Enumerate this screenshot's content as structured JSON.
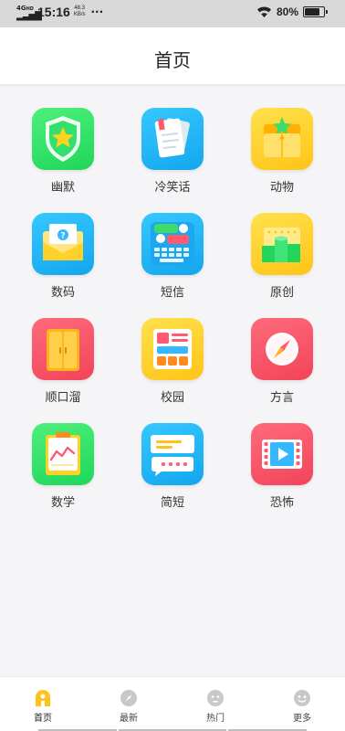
{
  "status_bar": {
    "network": "4G",
    "network_hd": "HD",
    "time": "15:16",
    "speed_value": "48.3",
    "speed_unit": "KB/s",
    "more": "···",
    "battery": "80%",
    "battery_level": 0.8
  },
  "header": {
    "title": "首页"
  },
  "categories": [
    {
      "label": "幽默",
      "icon": "shield-star-icon",
      "color": "green"
    },
    {
      "label": "冷笑话",
      "icon": "notebook-icon",
      "color": "blue"
    },
    {
      "label": "动物",
      "icon": "folder-star-icon",
      "color": "yellow"
    },
    {
      "label": "数码",
      "icon": "envelope-question-icon",
      "color": "blue"
    },
    {
      "label": "短信",
      "icon": "chat-keyboard-icon",
      "color": "blue"
    },
    {
      "label": "原创",
      "icon": "bar-chart-icon",
      "color": "yellow"
    },
    {
      "label": "顺口溜",
      "icon": "cabinet-icon",
      "color": "red"
    },
    {
      "label": "校园",
      "icon": "board-icon",
      "color": "yellow"
    },
    {
      "label": "方言",
      "icon": "compass-icon",
      "color": "red"
    },
    {
      "label": "数学",
      "icon": "clipboard-chart-icon",
      "color": "green"
    },
    {
      "label": "简短",
      "icon": "message-lines-icon",
      "color": "blue"
    },
    {
      "label": "恐怖",
      "icon": "film-play-icon",
      "color": "red"
    }
  ],
  "tabbar": {
    "items": [
      {
        "label": "首页",
        "icon": "home-icon",
        "active": true
      },
      {
        "label": "最新",
        "icon": "compass-small-icon",
        "active": false
      },
      {
        "label": "热门",
        "icon": "face-icon",
        "active": false
      },
      {
        "label": "更多",
        "icon": "face-smile-icon",
        "active": false
      }
    ]
  },
  "colors": {
    "green": "#25dc61",
    "blue": "#1cb2f5",
    "yellow": "#ffcd25",
    "red": "#f64d62",
    "tab_active": "#ffc21a",
    "tab_inactive": "#c8c8c8"
  }
}
